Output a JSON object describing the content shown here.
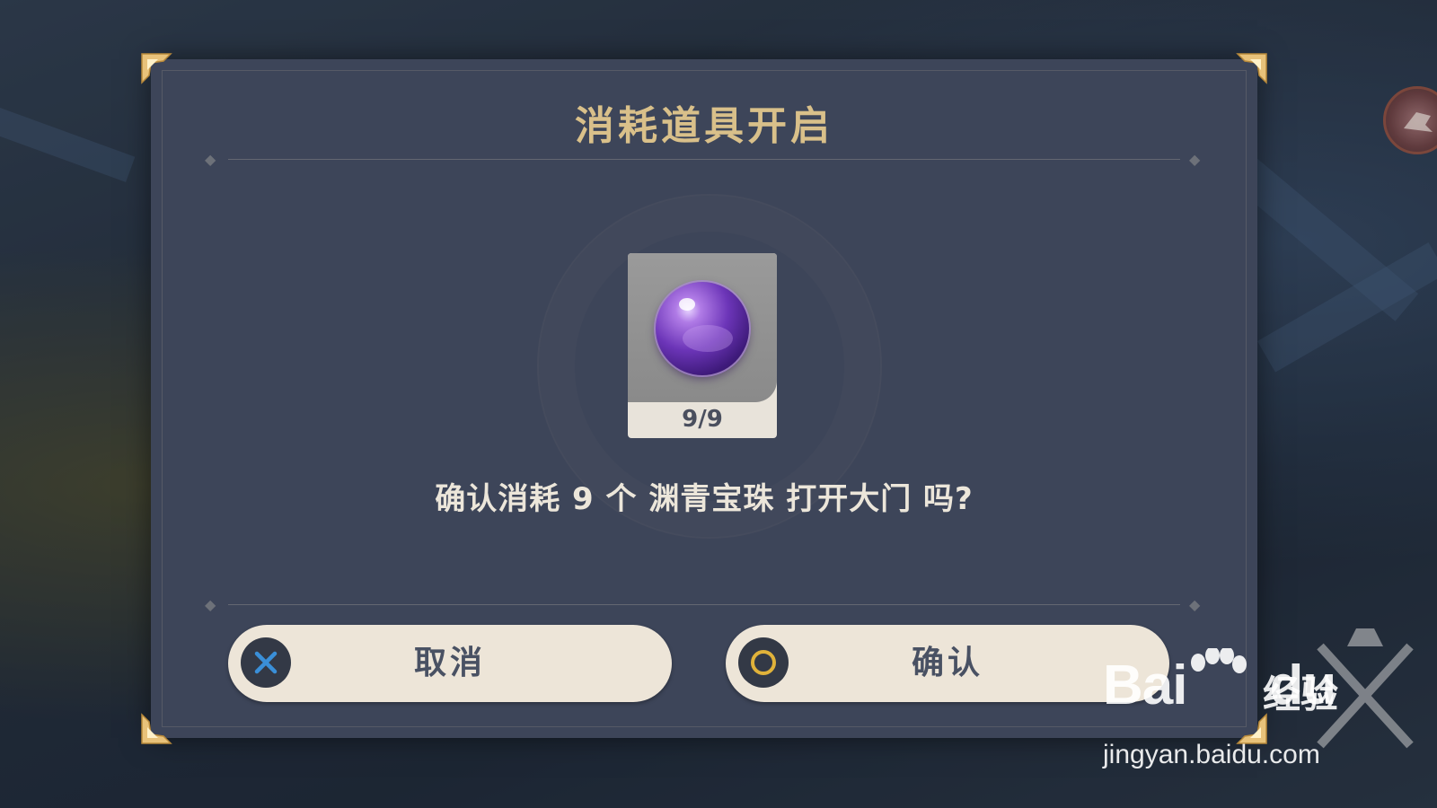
{
  "dialog": {
    "title": "消耗道具开启",
    "item": {
      "icon": "abyssal-pearl-icon",
      "count": "9/9"
    },
    "prompt": "确认消耗 9 个 渊青宝珠 打开大门 吗?",
    "buttons": {
      "cancel": {
        "label": "取消",
        "icon": "cross-icon"
      },
      "confirm": {
        "label": "确认",
        "icon": "circle-icon"
      }
    }
  },
  "watermark": {
    "brand_left": "Bai",
    "brand_right": "du",
    "brand_suffix": "经验",
    "url": "jingyan.baidu.com"
  },
  "colors": {
    "dialog_bg": "#3d4559",
    "title_gold": "#d9c08a",
    "button_bg": "#ede5d8",
    "cancel_icon": "#3a8fd8",
    "confirm_icon": "#e0b23a",
    "orb_purple": "#6c35b8"
  }
}
